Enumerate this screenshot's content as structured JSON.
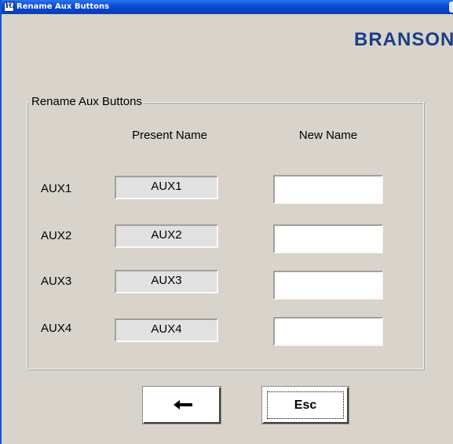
{
  "window": {
    "title": "Rename Aux Buttons",
    "app_icon_text": "YG"
  },
  "brand": {
    "logo_text": "BRANSON"
  },
  "group": {
    "legend": "Rename Aux Buttons",
    "columns": {
      "present": "Present Name",
      "new": "New Name"
    },
    "rows": [
      {
        "label": "AUX1",
        "present": "AUX1",
        "new_value": ""
      },
      {
        "label": "AUX2",
        "present": "AUX2",
        "new_value": ""
      },
      {
        "label": "AUX3",
        "present": "AUX3",
        "new_value": ""
      },
      {
        "label": "AUX4",
        "present": "AUX4",
        "new_value": ""
      }
    ]
  },
  "buttons": {
    "enter_icon": "enter-arrow-icon",
    "esc_label": "Esc"
  },
  "colors": {
    "window_bg": "#d8d4cc",
    "title_bar": "#0a4cd8",
    "brand": "#1a3e86"
  }
}
